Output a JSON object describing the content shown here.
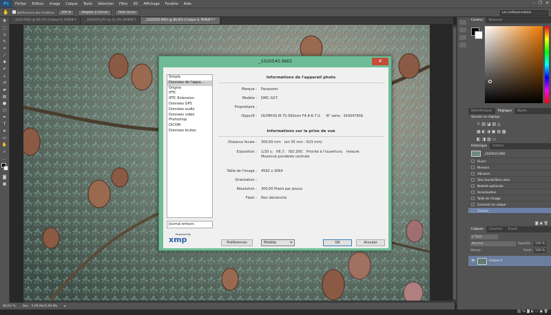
{
  "app": {
    "logo": "Ps"
  },
  "menubar": {
    "items": [
      "Fichier",
      "Edition",
      "Image",
      "Calque",
      "Texte",
      "Sélection",
      "Filtre",
      "3D",
      "Affichage",
      "Fenêtre",
      "Aide"
    ],
    "window_controls": [
      "–",
      "❐",
      "✕"
    ]
  },
  "options_bar": {
    "all_windows": "Défilement des fenêtres",
    "zoom_100": "100 %",
    "fit_screen": "Adapter à l'écran",
    "fill_screen": "Plein écran",
    "workspace": "Les indispensables"
  },
  "doc_tabs": [
    "_1015.RW2 @ 80,3% (Calque 0, RVB/8*)",
    "_1020555.JPG @ 21,4% (RVB/8*)",
    "_1020545.RW2 @ 80,6% (Calque 0, RVB/8*) *"
  ],
  "status": {
    "zoom": "80,63 %",
    "doc": "Doc : 5,99 Mo/5,99 Mo"
  },
  "right_panel": {
    "color_tabs": [
      "Couleur",
      "Nuancier"
    ],
    "adjust_tabs": [
      "Bibliothèques",
      "Réglages",
      "Styles"
    ],
    "adjust_title": "Ajouter un réglage",
    "history_tabs": [
      "Historique",
      "Actions"
    ],
    "history_file": "_1020545.RW2",
    "history_items": [
      "Ouvrir",
      "Niveaux",
      "Vibrance",
      "Tons foncés/Tons clairs",
      "Netteté optimisée",
      "Accentuation",
      "Taille de l'image",
      "Convertir en calque",
      "Contour"
    ],
    "layers_tabs": [
      "Calques",
      "Couches",
      "Tracés"
    ],
    "layer_kind": "ρ Type",
    "blend": "Normal",
    "opacity_label": "Opacité :",
    "opacity": "100 %",
    "lock_label": "Verrou :",
    "fill_label": "Fond :",
    "fill": "100 %",
    "layer_name": "Calque 0"
  },
  "dialog": {
    "title": "_1020545.RW2",
    "categories": [
      "Simple",
      "Données de l'appa...",
      "Origine",
      "IPTC",
      "IPTC Extension",
      "Données GPS",
      "Données audio",
      "Données vidéo",
      "Photoshop",
      "DICOM",
      "Données brutes"
    ],
    "selected": "Données de l'appa...",
    "log": "Journal erreurs",
    "xmp_powered": "Powered By",
    "xmp_logo": "xmp",
    "camera_heading": "Informations de l'appareil photo",
    "camera": {
      "make_label": "Marque :",
      "make": "Panasonic",
      "model_label": "Modèle :",
      "model": "DMC-GX7",
      "owner_label": "Propriétaire :",
      "owner": "",
      "lens_label": "Objectif :",
      "lens": "OLYMPUS M.75-300mm F4.8-6.7 II;     N° série : 343047956"
    },
    "shot_heading": "Informations sur la prise de vue",
    "shot": {
      "focal_label": "Distance focale :",
      "focal": "300,00 mm   (en 35 mm : 623 mm)",
      "exposure_label": "Exposition :",
      "exposure": "1/20 s;   f/6,7;   ISO 200;   Priorité à l'ouverture;   mesure",
      "exposure2": "Moyenne pondérée centrale",
      "size_label": "Taille de l'image :",
      "size": "4592 x 3064",
      "orient_label": "Orientation :",
      "orient": "",
      "res_label": "Résolution :",
      "res": "300,00 Pixels par pouce",
      "flash_label": "Flash :",
      "flash": "Non déclenché"
    },
    "buttons": {
      "prefs": "Préférences",
      "model": "Modèle",
      "ok": "OK",
      "cancel": "Annuler",
      "close": "✕"
    }
  }
}
